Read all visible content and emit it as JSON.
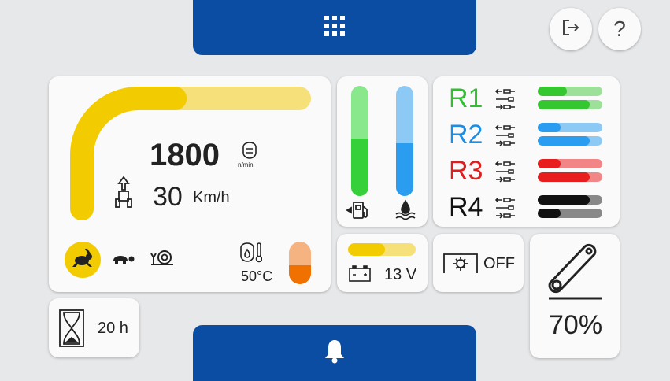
{
  "theme": {
    "nav_blue": "#0a4da2",
    "yellow": "#f2cc00",
    "yellow_light": "#f5e07a",
    "green": "#35d03a",
    "green_light": "#8ae88c",
    "blue": "#2a9df0",
    "blue_light": "#8ccaf5",
    "orange": "#f07000",
    "orange_light": "#f5b382"
  },
  "top_nav": {
    "icon": "grid-menu-icon"
  },
  "bottom_nav": {
    "icon": "bell-icon"
  },
  "buttons": {
    "logout_icon": "logout-icon",
    "help_label": "?"
  },
  "engine": {
    "rpm_value": "1800",
    "rpm_unit": "n/min",
    "rpm_level": 0.59,
    "speed_value": "30",
    "speed_unit": "Km/h",
    "speed_modes": [
      "rabbit-icon",
      "turtle-icon",
      "snail-icon"
    ],
    "speed_mode_selected": "rabbit-icon"
  },
  "oil": {
    "temperature": "50°C",
    "level": 0.45
  },
  "tanks": {
    "fuel_level": 0.52,
    "adblue_level": 0.48
  },
  "remotes": [
    {
      "label": "R1",
      "color": "#2fbf2f",
      "bar_color": "#35c72f",
      "bar_light": "#9de09a",
      "top": 0.45,
      "bottom": 0.8
    },
    {
      "label": "R2",
      "color": "#1b8ee8",
      "bar_color": "#2a9df0",
      "bar_light": "#8ccaf5",
      "top": 0.35,
      "bottom": 0.8
    },
    {
      "label": "R3",
      "color": "#e01e1e",
      "bar_color": "#e81e1e",
      "bar_light": "#f28585",
      "top": 0.35,
      "bottom": 0.8
    },
    {
      "label": "R4",
      "color": "#111111",
      "bar_color": "#111111",
      "bar_light": "#888888",
      "top": 0.8,
      "bottom": 0.35
    }
  ],
  "battery": {
    "voltage": "13 V",
    "level": 0.55
  },
  "pto": {
    "state": "OFF"
  },
  "hours": {
    "value": "20 h"
  },
  "hitch": {
    "percent": "70%"
  }
}
